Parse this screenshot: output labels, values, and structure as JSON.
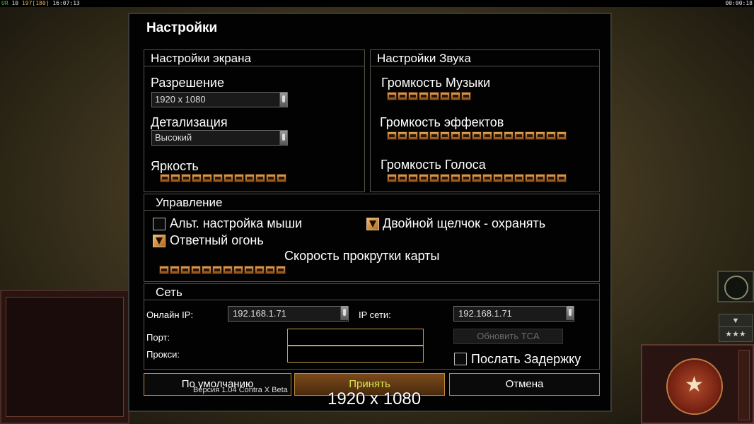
{
  "hud": {
    "left_prefix": "UR",
    "left_a": "10",
    "left_b": "197",
    "left_c": "[180]",
    "left_time": "16:07:13",
    "right_time": "00:00:18"
  },
  "background": {
    "arrow_down": "▼",
    "stars": "★★★",
    "emblem_star": "★"
  },
  "dialog": {
    "title": "Настройки",
    "screen": {
      "header": "Настройки экрана",
      "resolution_label": "Разрешение",
      "resolution_value": "1920 x 1080",
      "detail_label": "Детализация",
      "detail_value": "Высокий",
      "brightness_label": "Яркость",
      "brightness_level": 12,
      "brightness_max": 12
    },
    "sound": {
      "header": "Настройки Звука",
      "music_label": "Громкость Музыки",
      "music_level": 8,
      "effects_label": "Громкость эффектов",
      "effects_level": 17,
      "voice_label": "Громкость Голоса",
      "voice_level": 17
    },
    "control": {
      "header": "Управление",
      "alt_mouse_label": "Альт. настройка мыши",
      "alt_mouse_checked": false,
      "double_click_label": "Двойной щелчок - охранять",
      "double_click_checked": true,
      "return_fire_label": "Ответный огонь",
      "return_fire_checked": true,
      "scroll_speed_label": "Скорость прокрутки карты",
      "scroll_speed_level": 12
    },
    "network": {
      "header": "Сеть",
      "online_ip_label": "Онлайн IP:",
      "online_ip_value": "192.168.1.71",
      "lan_ip_label": "IP сети:",
      "lan_ip_value": "192.168.1.71",
      "port_label": "Порт:",
      "proxy_label": "Прокси:",
      "update_tca_label": "Обновить TCA",
      "send_delay_label": "Послать Задержку",
      "send_delay_checked": false
    },
    "buttons": {
      "default_label": "По умолчанию",
      "accept_label": "Принять",
      "cancel_label": "Отмена"
    },
    "version_text": "Версия 1.04 Contra X Beta",
    "overlay_resolution": "1920 x 1080"
  }
}
